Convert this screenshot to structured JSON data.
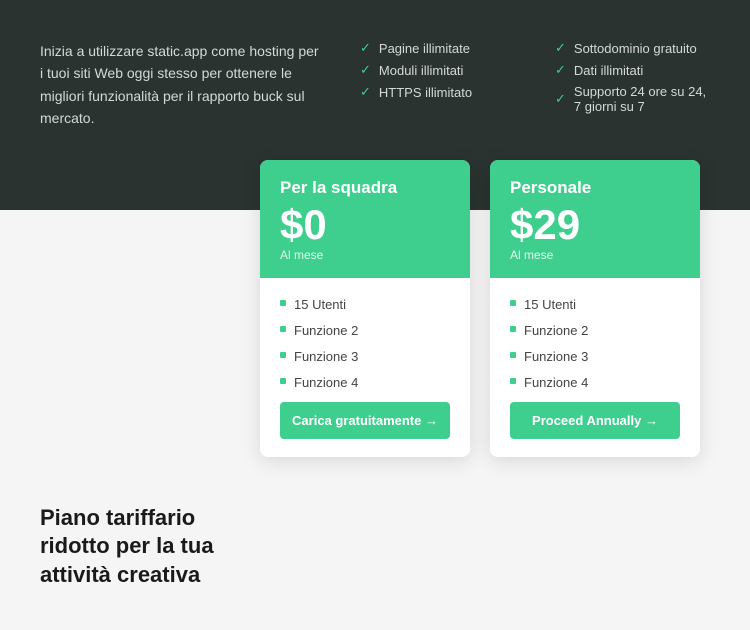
{
  "top": {
    "description": "Inizia a utilizzare static.app come hosting per i tuoi siti Web oggi stesso per ottenere le migliori funzionalità per il rapporto buck sul mercato.",
    "features_col1": [
      "Pagine illimitate",
      "Moduli illimitati",
      "HTTPS illimitato"
    ],
    "features_col2": [
      "Sottodominio gratuito",
      "Dati illimitati",
      "Supporto 24 ore su 24, 7 giorni su 7"
    ]
  },
  "cards": [
    {
      "title": "Per la squadra",
      "price": "$0",
      "period": "Al mese",
      "features": [
        "15 Utenti",
        "Funzione 2",
        "Funzione 3",
        "Funzione 4"
      ],
      "button_label": "Carica gratuitamente →"
    },
    {
      "title": "Personale",
      "price": "$29",
      "period": "Al mese",
      "features": [
        "15 Utenti",
        "Funzione 2",
        "Funzione 3",
        "Funzione 4"
      ],
      "button_label": "Proceed Annually →"
    }
  ],
  "bottom_left": {
    "heading": "Piano tariffario ridotto per la tua attività creativa"
  }
}
